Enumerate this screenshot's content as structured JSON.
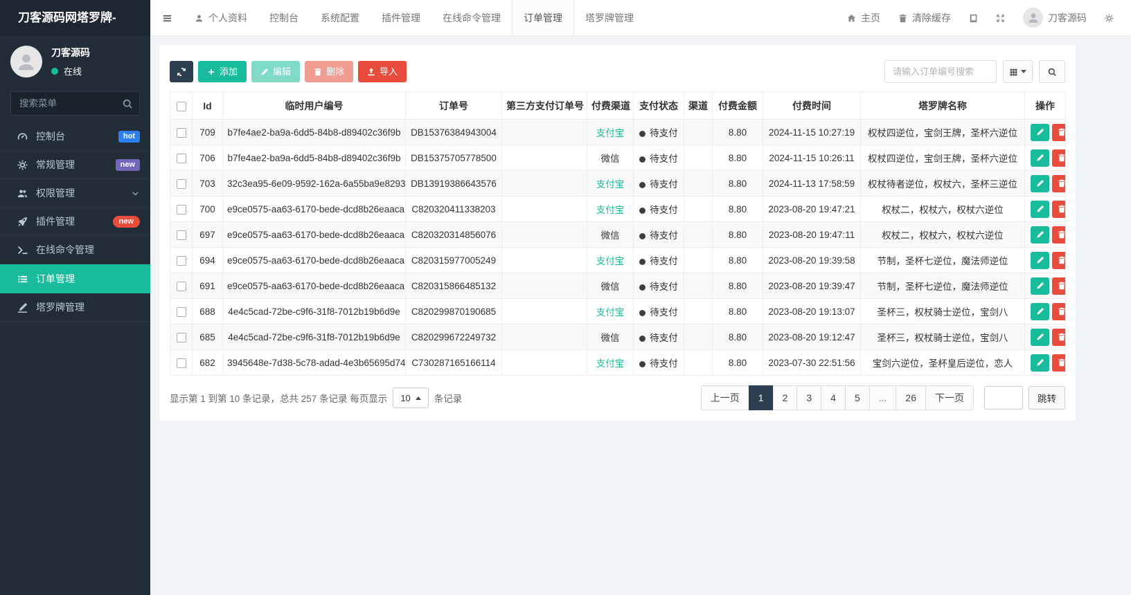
{
  "brand": "刀客源码网塔罗牌-",
  "topnav": {
    "items": [
      {
        "key": "profile",
        "label": "个人资料",
        "icon": "person"
      },
      {
        "key": "dashboard",
        "label": "控制台"
      },
      {
        "key": "system-config",
        "label": "系统配置"
      },
      {
        "key": "addon-manage",
        "label": "插件管理"
      },
      {
        "key": "command-manage",
        "label": "在线命令管理"
      },
      {
        "key": "order-manage",
        "label": "订单管理",
        "active": true
      },
      {
        "key": "tarot-manage",
        "label": "塔罗牌管理"
      }
    ],
    "home_label": "主页",
    "clear_cache_label": "清除缓存",
    "username": "刀客源码"
  },
  "sidebar": {
    "username": "刀客源码",
    "online_status": "在线",
    "search_placeholder": "搜索菜单",
    "menu": [
      {
        "key": "dashboard",
        "label": "控制台",
        "icon": "dashboard",
        "badge": "hot",
        "badge_color": "#2e7ff0"
      },
      {
        "key": "general",
        "label": "常规管理",
        "icon": "cogs",
        "badge": "new",
        "badge_color": "#7266ba"
      },
      {
        "key": "auth",
        "label": "权限管理",
        "icon": "users",
        "chevron": true
      },
      {
        "key": "addon",
        "label": "插件管理",
        "icon": "rocket",
        "badge": "new",
        "badge_color": "#e74c3c",
        "badge_pill": true
      },
      {
        "key": "command",
        "label": "在线命令管理",
        "icon": "terminal"
      },
      {
        "key": "order",
        "label": "订单管理",
        "icon": "list",
        "active": true
      },
      {
        "key": "tarot",
        "label": "塔罗牌管理",
        "icon": "pen"
      }
    ]
  },
  "toolbar": {
    "add_label": "添加",
    "edit_label": "编辑",
    "delete_label": "删除",
    "import_label": "导入",
    "search_placeholder": "请输入订单编号搜索"
  },
  "table": {
    "columns": [
      "Id",
      "临时用户编号",
      "订单号",
      "第三方支付订单号",
      "付费渠道",
      "支付状态",
      "渠道",
      "付费金额",
      "付费时间",
      "塔罗牌名称",
      "操作"
    ],
    "rows": [
      {
        "id": "709",
        "user_id": "b7fe4ae2-ba9a-6dd5-84b8-d89402c36f9b",
        "order_no": "DB15376384943004",
        "third_party_no": "",
        "pay_channel": "支付宝",
        "pay_status": "待支付",
        "channel": "",
        "amount": "8.80",
        "pay_time": "2024-11-15 10:27:19",
        "tarot_names": "权杖四逆位，宝剑王牌，圣杯六逆位"
      },
      {
        "id": "706",
        "user_id": "b7fe4ae2-ba9a-6dd5-84b8-d89402c36f9b",
        "order_no": "DB15375705778500",
        "third_party_no": "",
        "pay_channel": "微信",
        "pay_status": "待支付",
        "channel": "",
        "amount": "8.80",
        "pay_time": "2024-11-15 10:26:11",
        "tarot_names": "权杖四逆位，宝剑王牌，圣杯六逆位"
      },
      {
        "id": "703",
        "user_id": "32c3ea95-6e09-9592-162a-6a55ba9e8293",
        "order_no": "DB13919386643576",
        "third_party_no": "",
        "pay_channel": "支付宝",
        "pay_status": "待支付",
        "channel": "",
        "amount": "8.80",
        "pay_time": "2024-11-13 17:58:59",
        "tarot_names": "权杖待者逆位，权杖六，圣杯三逆位"
      },
      {
        "id": "700",
        "user_id": "e9ce0575-aa63-6170-bede-dcd8b26eaaca",
        "order_no": "C820320411338203",
        "third_party_no": "",
        "pay_channel": "支付宝",
        "pay_status": "待支付",
        "channel": "",
        "amount": "8.80",
        "pay_time": "2023-08-20 19:47:21",
        "tarot_names": "权杖二，权杖六，权杖六逆位"
      },
      {
        "id": "697",
        "user_id": "e9ce0575-aa63-6170-bede-dcd8b26eaaca",
        "order_no": "C820320314856076",
        "third_party_no": "",
        "pay_channel": "微信",
        "pay_status": "待支付",
        "channel": "",
        "amount": "8.80",
        "pay_time": "2023-08-20 19:47:11",
        "tarot_names": "权杖二，权杖六，权杖六逆位"
      },
      {
        "id": "694",
        "user_id": "e9ce0575-aa63-6170-bede-dcd8b26eaaca",
        "order_no": "C820315977005249",
        "third_party_no": "",
        "pay_channel": "支付宝",
        "pay_status": "待支付",
        "channel": "",
        "amount": "8.80",
        "pay_time": "2023-08-20 19:39:58",
        "tarot_names": "节制，圣杯七逆位，魔法师逆位"
      },
      {
        "id": "691",
        "user_id": "e9ce0575-aa63-6170-bede-dcd8b26eaaca",
        "order_no": "C820315866485132",
        "third_party_no": "",
        "pay_channel": "微信",
        "pay_status": "待支付",
        "channel": "",
        "amount": "8.80",
        "pay_time": "2023-08-20 19:39:47",
        "tarot_names": "节制，圣杯七逆位，魔法师逆位"
      },
      {
        "id": "688",
        "user_id": "4e4c5cad-72be-c9f6-31f8-7012b19b6d9e",
        "order_no": "C820299870190685",
        "third_party_no": "",
        "pay_channel": "支付宝",
        "pay_status": "待支付",
        "channel": "",
        "amount": "8.80",
        "pay_time": "2023-08-20 19:13:07",
        "tarot_names": "圣杯三，权杖骑士逆位，宝剑八"
      },
      {
        "id": "685",
        "user_id": "4e4c5cad-72be-c9f6-31f8-7012b19b6d9e",
        "order_no": "C820299672249732",
        "third_party_no": "",
        "pay_channel": "微信",
        "pay_status": "待支付",
        "channel": "",
        "amount": "8.80",
        "pay_time": "2023-08-20 19:12:47",
        "tarot_names": "圣杯三，权杖骑士逆位，宝剑八"
      },
      {
        "id": "682",
        "user_id": "3945648e-7d38-5c78-adad-4e3b65695d74",
        "order_no": "C730287165166114",
        "third_party_no": "",
        "pay_channel": "支付宝",
        "pay_status": "待支付",
        "channel": "",
        "amount": "8.80",
        "pay_time": "2023-07-30 22:51:56",
        "tarot_names": "宝剑六逆位，圣杯皇后逆位，恋人"
      }
    ]
  },
  "pagination": {
    "summary_prefix": "显示第 1 到第 10 条记录，总共 257 条记录 每页显示",
    "page_size": "10",
    "summary_suffix": "条记录",
    "prev_label": "上一页",
    "pages": [
      "1",
      "2",
      "3",
      "4",
      "5",
      "...",
      "26"
    ],
    "active_page": "1",
    "next_label": "下一页",
    "jump_label": "跳转"
  },
  "colors": {
    "accent": "#18bc9c",
    "primary_dark": "#2c3e50",
    "danger": "#e74c3c"
  }
}
